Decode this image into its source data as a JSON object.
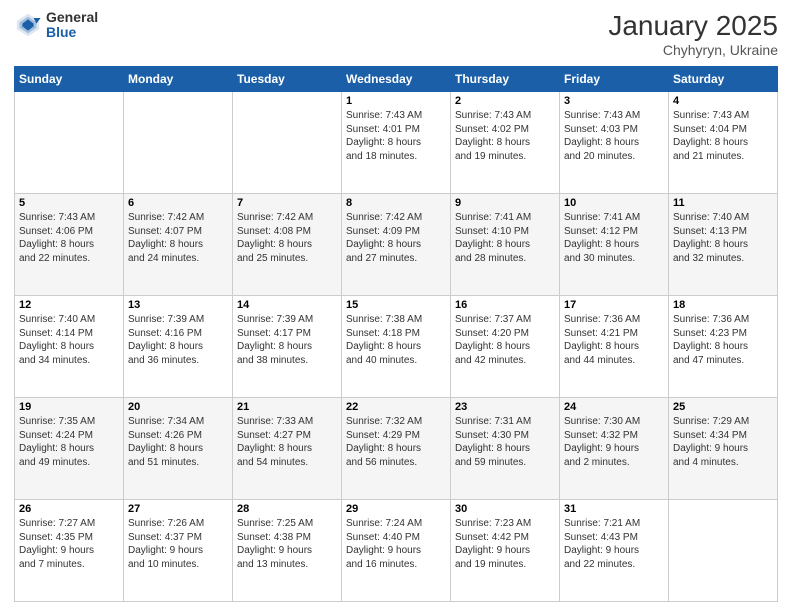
{
  "logo": {
    "general": "General",
    "blue": "Blue"
  },
  "title": "January 2025",
  "subtitle": "Chyhyryn, Ukraine",
  "weekdays": [
    "Sunday",
    "Monday",
    "Tuesday",
    "Wednesday",
    "Thursday",
    "Friday",
    "Saturday"
  ],
  "weeks": [
    [
      {
        "day": "",
        "info": ""
      },
      {
        "day": "",
        "info": ""
      },
      {
        "day": "",
        "info": ""
      },
      {
        "day": "1",
        "info": "Sunrise: 7:43 AM\nSunset: 4:01 PM\nDaylight: 8 hours\nand 18 minutes."
      },
      {
        "day": "2",
        "info": "Sunrise: 7:43 AM\nSunset: 4:02 PM\nDaylight: 8 hours\nand 19 minutes."
      },
      {
        "day": "3",
        "info": "Sunrise: 7:43 AM\nSunset: 4:03 PM\nDaylight: 8 hours\nand 20 minutes."
      },
      {
        "day": "4",
        "info": "Sunrise: 7:43 AM\nSunset: 4:04 PM\nDaylight: 8 hours\nand 21 minutes."
      }
    ],
    [
      {
        "day": "5",
        "info": "Sunrise: 7:43 AM\nSunset: 4:06 PM\nDaylight: 8 hours\nand 22 minutes."
      },
      {
        "day": "6",
        "info": "Sunrise: 7:42 AM\nSunset: 4:07 PM\nDaylight: 8 hours\nand 24 minutes."
      },
      {
        "day": "7",
        "info": "Sunrise: 7:42 AM\nSunset: 4:08 PM\nDaylight: 8 hours\nand 25 minutes."
      },
      {
        "day": "8",
        "info": "Sunrise: 7:42 AM\nSunset: 4:09 PM\nDaylight: 8 hours\nand 27 minutes."
      },
      {
        "day": "9",
        "info": "Sunrise: 7:41 AM\nSunset: 4:10 PM\nDaylight: 8 hours\nand 28 minutes."
      },
      {
        "day": "10",
        "info": "Sunrise: 7:41 AM\nSunset: 4:12 PM\nDaylight: 8 hours\nand 30 minutes."
      },
      {
        "day": "11",
        "info": "Sunrise: 7:40 AM\nSunset: 4:13 PM\nDaylight: 8 hours\nand 32 minutes."
      }
    ],
    [
      {
        "day": "12",
        "info": "Sunrise: 7:40 AM\nSunset: 4:14 PM\nDaylight: 8 hours\nand 34 minutes."
      },
      {
        "day": "13",
        "info": "Sunrise: 7:39 AM\nSunset: 4:16 PM\nDaylight: 8 hours\nand 36 minutes."
      },
      {
        "day": "14",
        "info": "Sunrise: 7:39 AM\nSunset: 4:17 PM\nDaylight: 8 hours\nand 38 minutes."
      },
      {
        "day": "15",
        "info": "Sunrise: 7:38 AM\nSunset: 4:18 PM\nDaylight: 8 hours\nand 40 minutes."
      },
      {
        "day": "16",
        "info": "Sunrise: 7:37 AM\nSunset: 4:20 PM\nDaylight: 8 hours\nand 42 minutes."
      },
      {
        "day": "17",
        "info": "Sunrise: 7:36 AM\nSunset: 4:21 PM\nDaylight: 8 hours\nand 44 minutes."
      },
      {
        "day": "18",
        "info": "Sunrise: 7:36 AM\nSunset: 4:23 PM\nDaylight: 8 hours\nand 47 minutes."
      }
    ],
    [
      {
        "day": "19",
        "info": "Sunrise: 7:35 AM\nSunset: 4:24 PM\nDaylight: 8 hours\nand 49 minutes."
      },
      {
        "day": "20",
        "info": "Sunrise: 7:34 AM\nSunset: 4:26 PM\nDaylight: 8 hours\nand 51 minutes."
      },
      {
        "day": "21",
        "info": "Sunrise: 7:33 AM\nSunset: 4:27 PM\nDaylight: 8 hours\nand 54 minutes."
      },
      {
        "day": "22",
        "info": "Sunrise: 7:32 AM\nSunset: 4:29 PM\nDaylight: 8 hours\nand 56 minutes."
      },
      {
        "day": "23",
        "info": "Sunrise: 7:31 AM\nSunset: 4:30 PM\nDaylight: 8 hours\nand 59 minutes."
      },
      {
        "day": "24",
        "info": "Sunrise: 7:30 AM\nSunset: 4:32 PM\nDaylight: 9 hours\nand 2 minutes."
      },
      {
        "day": "25",
        "info": "Sunrise: 7:29 AM\nSunset: 4:34 PM\nDaylight: 9 hours\nand 4 minutes."
      }
    ],
    [
      {
        "day": "26",
        "info": "Sunrise: 7:27 AM\nSunset: 4:35 PM\nDaylight: 9 hours\nand 7 minutes."
      },
      {
        "day": "27",
        "info": "Sunrise: 7:26 AM\nSunset: 4:37 PM\nDaylight: 9 hours\nand 10 minutes."
      },
      {
        "day": "28",
        "info": "Sunrise: 7:25 AM\nSunset: 4:38 PM\nDaylight: 9 hours\nand 13 minutes."
      },
      {
        "day": "29",
        "info": "Sunrise: 7:24 AM\nSunset: 4:40 PM\nDaylight: 9 hours\nand 16 minutes."
      },
      {
        "day": "30",
        "info": "Sunrise: 7:23 AM\nSunset: 4:42 PM\nDaylight: 9 hours\nand 19 minutes."
      },
      {
        "day": "31",
        "info": "Sunrise: 7:21 AM\nSunset: 4:43 PM\nDaylight: 9 hours\nand 22 minutes."
      },
      {
        "day": "",
        "info": ""
      }
    ]
  ]
}
